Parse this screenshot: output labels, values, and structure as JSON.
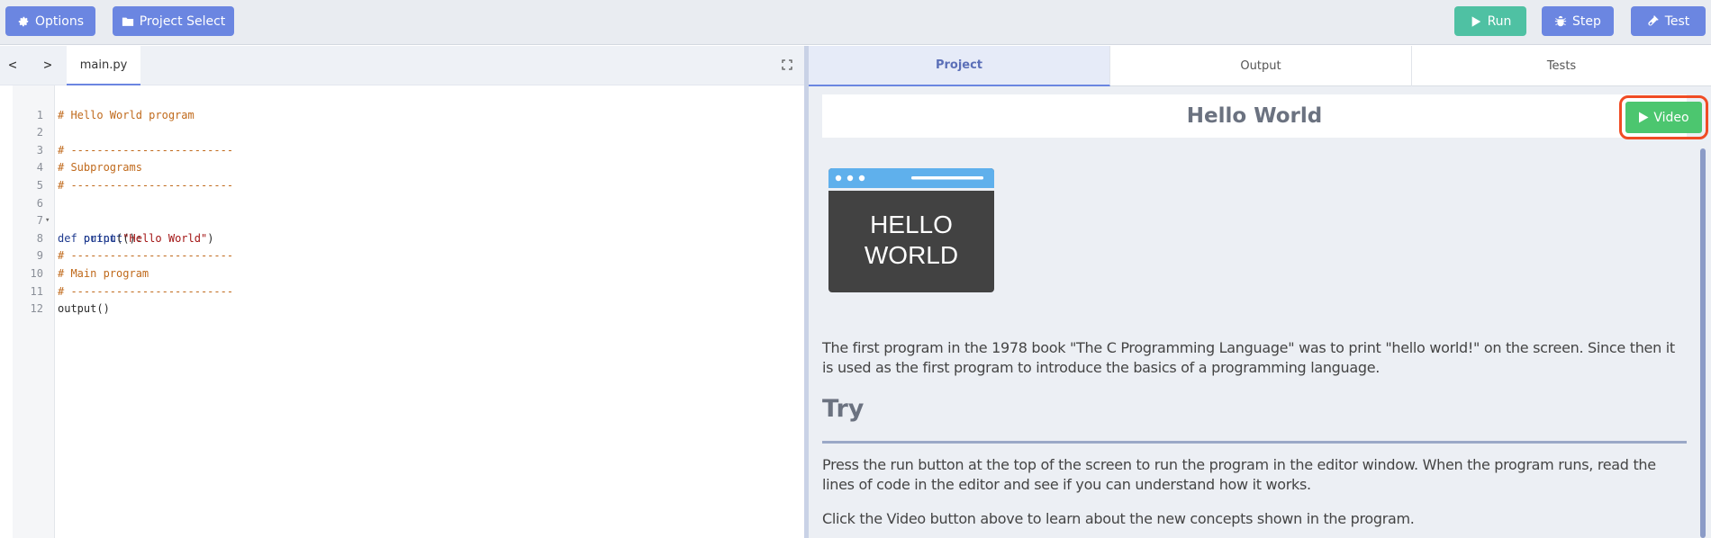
{
  "toolbar": {
    "options_label": "Options",
    "project_select_label": "Project Select",
    "run_label": "Run",
    "step_label": "Step",
    "test_label": "Test"
  },
  "editor": {
    "back_arrow": "<",
    "forward_arrow": ">",
    "file_tab": "main.py",
    "lines": [
      {
        "n": "1",
        "text": "# Hello World program"
      },
      {
        "n": "2",
        "text": ""
      },
      {
        "n": "3",
        "text": "# -------------------------"
      },
      {
        "n": "4",
        "text": "# Subprograms"
      },
      {
        "n": "5",
        "text": "# -------------------------"
      },
      {
        "n": "6",
        "kw": "def ",
        "fn": "output",
        "rest": "():"
      },
      {
        "n": "7",
        "indent": "    ",
        "fn": "print",
        "paren": "(",
        "str": "\"Hello World\"",
        "close": ")"
      },
      {
        "n": "8",
        "text": ""
      },
      {
        "n": "9",
        "text": "# -------------------------"
      },
      {
        "n": "10",
        "text": "# Main program"
      },
      {
        "n": "11",
        "text": "# -------------------------"
      },
      {
        "n": "12",
        "text": "output()"
      }
    ]
  },
  "right_panel": {
    "tabs": [
      "Project",
      "Output",
      "Tests"
    ],
    "title": "Hello World",
    "video_label": "Video",
    "image_text_line1": "HELLO",
    "image_text_line2": "WORLD",
    "intro": "The first program in the 1978 book \"The C Programming Language\" was to print \"hello world!\" on the screen. Since then it is used as the first program to introduce the basics of a programming language.",
    "try_heading": "Try",
    "try_para1": "Press the run button at the top of the screen to run the program in the editor window. When the program runs, read the lines of code in the editor and see if you can understand how it works.",
    "try_para2": "Click the Video button above to learn about the new concepts shown in the program."
  },
  "colors": {
    "toolbar_button": "#6b86e1",
    "run_button": "#4fc1a3",
    "video_button": "#4cc66f",
    "highlight_box": "#f04c24"
  }
}
